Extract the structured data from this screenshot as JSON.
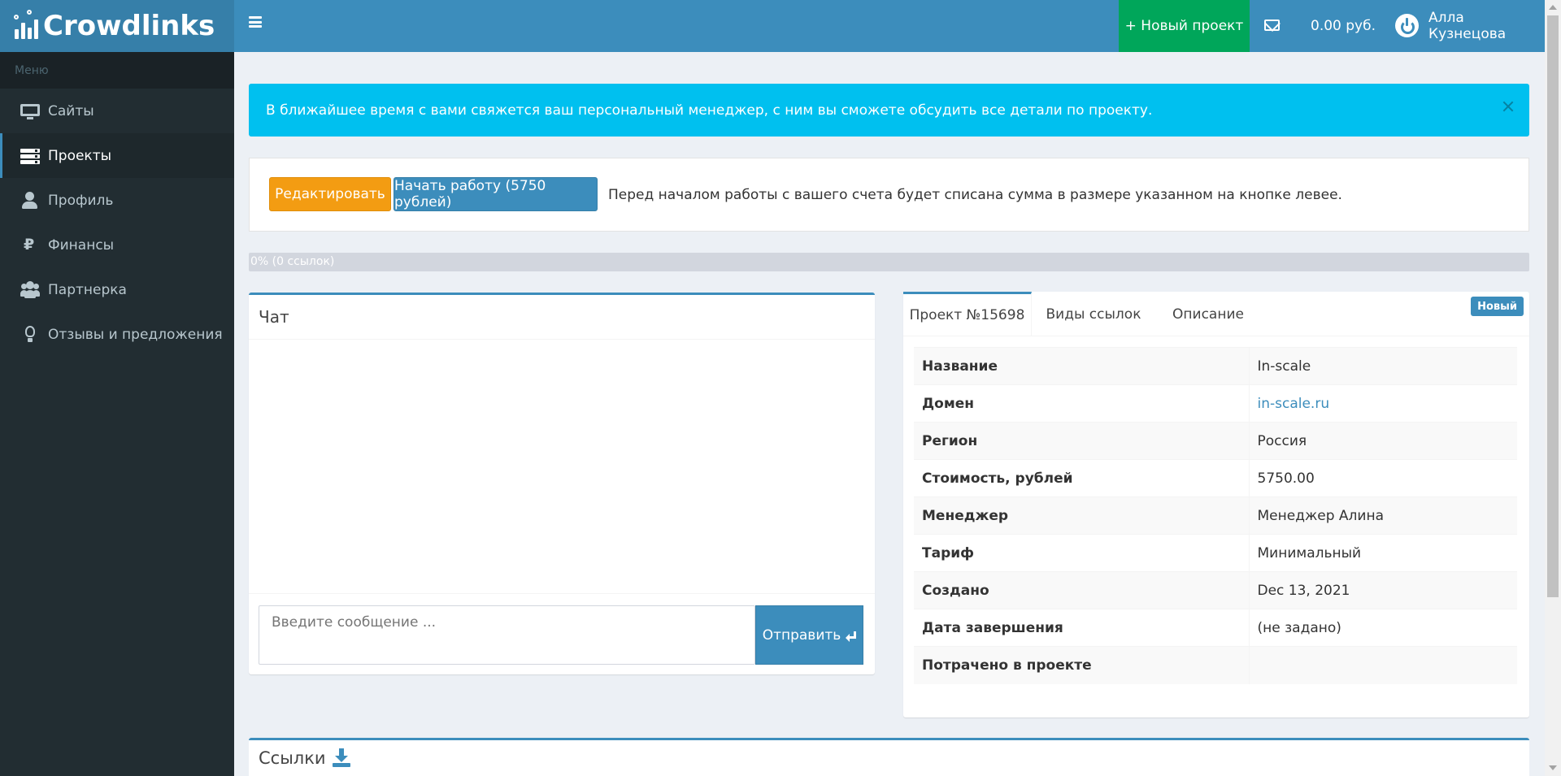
{
  "header": {
    "brand": "Crowdlinks",
    "new_project": "+ Новый проект",
    "balance": "0.00 руб.",
    "username": "Алла Кузнецова"
  },
  "sidebar": {
    "menu_header": "Меню",
    "items": [
      {
        "label": "Сайты",
        "icon": "monitor-icon"
      },
      {
        "label": "Проекты",
        "icon": "server-icon",
        "active": true
      },
      {
        "label": "Профиль",
        "icon": "user-icon"
      },
      {
        "label": "Финансы",
        "icon": "ruble-icon"
      },
      {
        "label": "Партнерка",
        "icon": "users-icon"
      },
      {
        "label": "Отзывы и предложения",
        "icon": "lightbulb-icon"
      }
    ]
  },
  "alert": {
    "text": "В ближайшее время с вами свяжется ваш персональный менеджер, с ним вы сможете обсудить все детали по проекту."
  },
  "actions": {
    "edit_label": "Редактировать",
    "start_label": "Начать работу (5750 рублей)",
    "note": "Перед началом работы с вашего счета будет списана сумма в размере указанном на кнопке левее."
  },
  "progress": {
    "percent": 0,
    "label": "0% (0 ссылок)"
  },
  "chat": {
    "title": "Чат",
    "placeholder": "Введите сообщение ...",
    "send_label": "Отправить"
  },
  "project": {
    "tabs": [
      "Проект №15698",
      "Виды ссылок",
      "Описание"
    ],
    "badge": "Новый",
    "rows": [
      {
        "key": "Название",
        "value": "In-scale"
      },
      {
        "key": "Домен",
        "value": "in-scale.ru",
        "link": true
      },
      {
        "key": "Регион",
        "value": "Россия"
      },
      {
        "key": "Стоимость, рублей",
        "value": "5750.00"
      },
      {
        "key": "Менеджер",
        "value": "Менеджер Алина"
      },
      {
        "key": "Тариф",
        "value": "Минимальный"
      },
      {
        "key": "Создано",
        "value": "Dec 13, 2021"
      },
      {
        "key": "Дата завершения",
        "value": "(не задано)"
      },
      {
        "key": "Потрачено в проекте",
        "value": ""
      }
    ]
  },
  "links": {
    "title": "Ссылки"
  },
  "colors": {
    "primary": "#3c8dbc",
    "success": "#00a65a",
    "warning": "#f39c12",
    "info": "#00c0ef",
    "sidebar": "#222d32"
  }
}
